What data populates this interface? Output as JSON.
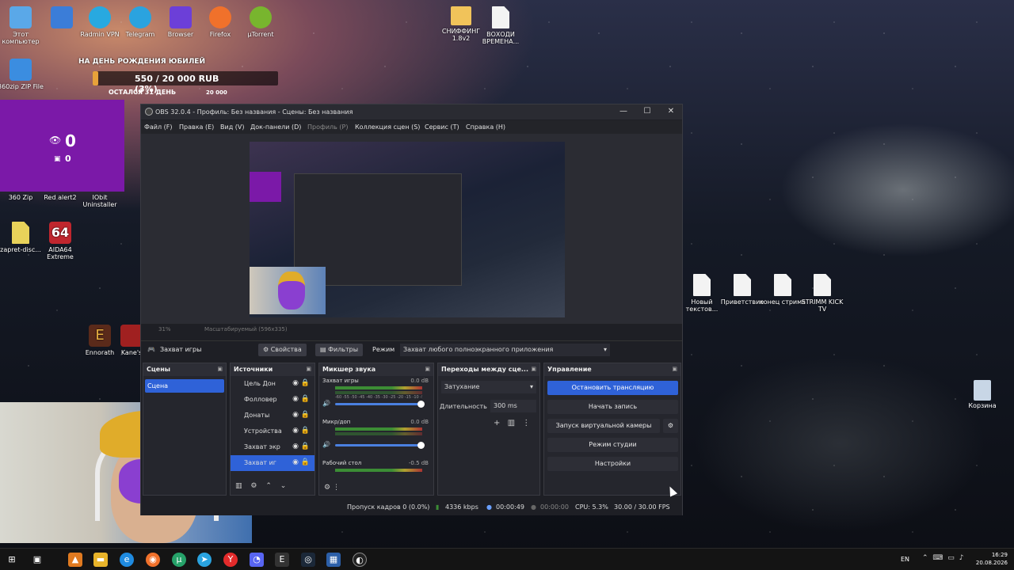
{
  "desktop": {
    "icons": [
      {
        "label": "Этот компьютер"
      },
      {
        "label": "Radmin VPN"
      },
      {
        "label": "Telegram"
      },
      {
        "label": "Browser"
      },
      {
        "label": "Firefox"
      },
      {
        "label": "µTorrent"
      },
      {
        "label": "СНИФФИНГ 1.8v2"
      },
      {
        "label": "ВОХОДИ ВРЕМЕНА..."
      },
      {
        "label": "360zip ZIP File"
      },
      {
        "label": "360 Zip"
      },
      {
        "label": "Red alert2"
      },
      {
        "label": "IObit Uninstaller"
      },
      {
        "label": "zapret-disc..."
      },
      {
        "label": "AIDA64 Extreme"
      },
      {
        "label": "Ennorath"
      },
      {
        "label": "Kane's"
      },
      {
        "label": "Новый текстов..."
      },
      {
        "label": "Приветствие"
      },
      {
        "label": "конец стрима"
      },
      {
        "label": "STRIMM KICK TV"
      },
      {
        "label": "Корзина"
      }
    ]
  },
  "donation": {
    "title": "НА ДЕНЬ РОЖДЕНИЯ ЮБИЛЕЙ",
    "amount": "550 / 20 000 RUB (3%)",
    "progress": 0.03,
    "days_left": "ОСТАЛСЯ 31 ДЕНЬ",
    "side_amount": "20 000"
  },
  "viewers": {
    "count": "0",
    "secondary": "0"
  },
  "obs": {
    "title": "OBS 32.0.4 - Профиль: Без названия - Сцены: Без названия",
    "window_controls": {
      "minimize": "—",
      "maximize": "☐",
      "close": "✕"
    },
    "menu": [
      {
        "label": "Файл (F)"
      },
      {
        "label": "Правка (E)"
      },
      {
        "label": "Вид (V)"
      },
      {
        "label": "Док-панели (D)"
      },
      {
        "label": "Профиль (P)"
      },
      {
        "label": "Коллекция сцен (S)"
      },
      {
        "label": "Сервис (T)"
      },
      {
        "label": "Справка (H)"
      }
    ],
    "zoom": {
      "value": "31%",
      "mode": "Масштабируемый (596x335)"
    },
    "source_toolbar": {
      "source_name": "Захват игры",
      "properties": "Свойства",
      "filters": "Фильтры",
      "mode_label": "Режим",
      "mode_value": "Захват любого полноэкранного приложения"
    },
    "scenes": {
      "header": "Сцены",
      "items": [
        "Сцена"
      ]
    },
    "sources": {
      "header": "Источники",
      "items": [
        "Цель Дон",
        "Фолловер",
        "Донаты",
        "Устройства",
        "Захват экр",
        "Захват иг"
      ]
    },
    "mixer": {
      "header": "Микшер звука",
      "channels": [
        {
          "name": "Захват игры",
          "db": "0.0 dB"
        },
        {
          "name": "Микр/доп",
          "db": "0.0 dB"
        },
        {
          "name": "Рабочий стол",
          "db": "-0.5 dB"
        }
      ],
      "scale": "-60 -55 -50 -45 -40 -35 -30 -25 -20 -15 -10 -5 0"
    },
    "transitions": {
      "header": "Переходы между сце...",
      "type": "Затухание",
      "duration_label": "Длительность",
      "duration_value": "300 ms"
    },
    "controls": {
      "header": "Управление",
      "stop_stream": "Остановить трансляцию",
      "start_record": "Начать запись",
      "virtual_cam": "Запуск виртуальной камеры",
      "studio_mode": "Режим студии",
      "settings": "Настройки"
    },
    "status": {
      "dropped": "Пропуск кадров 0 (0.0%)",
      "bitrate": "4336 kbps",
      "stream_time": "00:00:49",
      "record_time": "00:00:00",
      "cpu": "CPU: 5.3%",
      "fps": "30.00 / 30.00 FPS"
    }
  },
  "taskbar": {
    "lang": "EN",
    "time": "16:29",
    "date": "20.08.2026"
  },
  "colors": {
    "accent": "#2f62d8",
    "overlay_purple": "#7b19a8"
  }
}
